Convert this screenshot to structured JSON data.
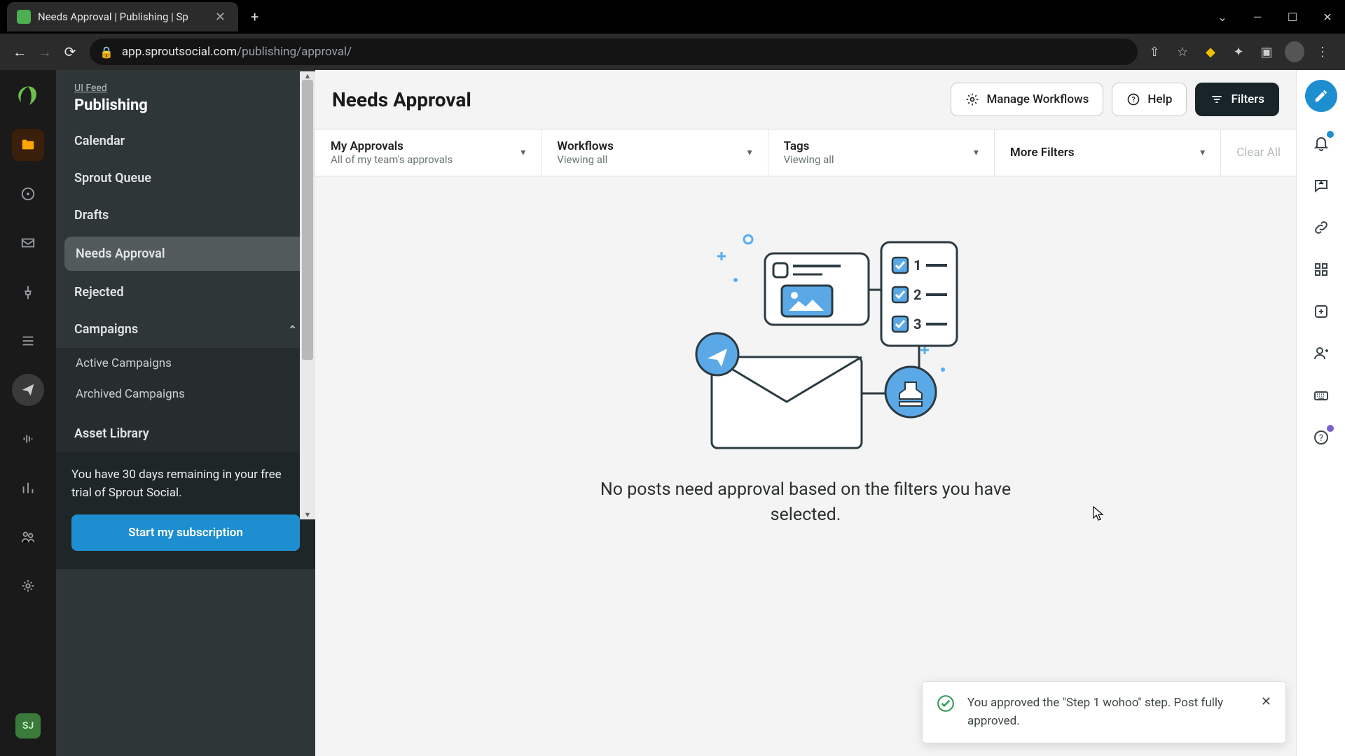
{
  "browser": {
    "tab_title": "Needs Approval | Publishing | Sp",
    "url_host": "app.sproutsocial.com",
    "url_path": "/publishing/approval/"
  },
  "sidebar": {
    "breadcrumb": "UI Feed",
    "section": "Publishing",
    "items": {
      "calendar": "Calendar",
      "queue": "Sprout Queue",
      "drafts": "Drafts",
      "needs_approval": "Needs Approval",
      "rejected": "Rejected",
      "campaigns": "Campaigns",
      "active_campaigns": "Active Campaigns",
      "archived_campaigns": "Archived Campaigns",
      "asset_library": "Asset Library"
    },
    "trial_text": "You have 30 days remaining in your free trial of Sprout Social.",
    "trial_cta": "Start my subscription",
    "avatar_initials": "SJ"
  },
  "header": {
    "title": "Needs Approval",
    "manage_workflows": "Manage Workflows",
    "help": "Help",
    "filters": "Filters"
  },
  "filters": {
    "my_approvals": {
      "label": "My Approvals",
      "sub": "All of my team's approvals"
    },
    "workflows": {
      "label": "Workflows",
      "sub": "Viewing all"
    },
    "tags": {
      "label": "Tags",
      "sub": "Viewing all"
    },
    "more": {
      "label": "More Filters"
    },
    "clear_all": "Clear All"
  },
  "empty": {
    "message": "No posts need approval based on the filters you have selected."
  },
  "toast": {
    "message": "You approved the \"Step 1 wohoo\" step. Post fully approved."
  },
  "colors": {
    "accent": "#1d8ecf",
    "sidebar_bg": "#2f3638",
    "dark_btn": "#18242a"
  }
}
